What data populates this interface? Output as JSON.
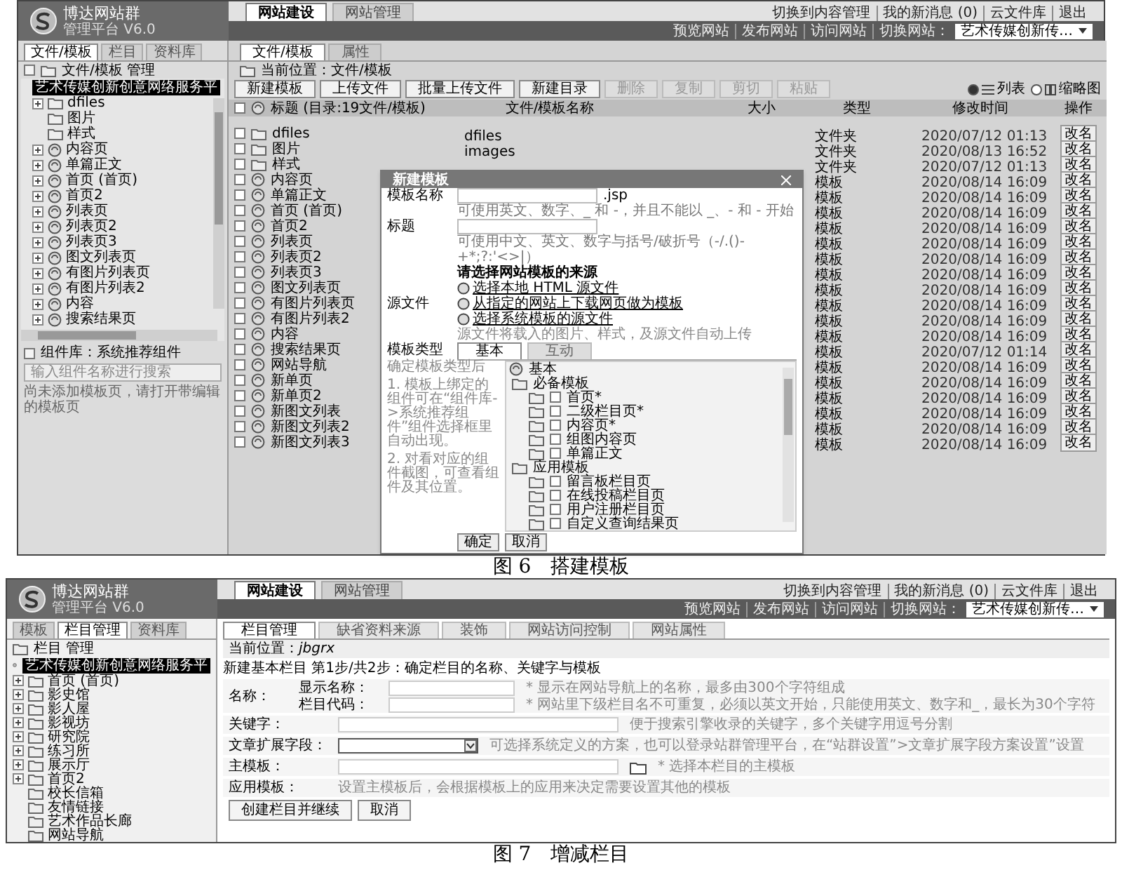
{
  "figure_6": {
    "header": {
      "logo": "博达网站群",
      "version": "管理平台 V6.0",
      "nav_tabs": [
        {
          "label": "网站建设",
          "selected": true
        },
        {
          "label": "网站管理",
          "selected": false
        }
      ],
      "top_links": [
        "切换到内容管理",
        "我的新消息 (0)",
        "云文件库",
        "退出"
      ],
      "site_links": [
        "预览网站",
        "发布网站",
        "访问网站",
        "切换网站："
      ],
      "site_select": "艺术传媒创新传…"
    },
    "sidebar": {
      "tabs": [
        {
          "label": "文件/模板",
          "selected": true
        },
        {
          "label": "栏目",
          "selected": false
        },
        {
          "label": "资料库",
          "selected": false
        }
      ],
      "title": "文件/模板 管理",
      "tree_root": {
        "label": "艺术传媒创新创意网络服务平",
        "selected": true
      },
      "tree_items": [
        {
          "label": "dfiles",
          "kind": "folder",
          "expandable": true
        },
        {
          "label": "图片",
          "kind": "folder",
          "expandable": false
        },
        {
          "label": "样式",
          "kind": "folder",
          "expandable": false
        },
        {
          "label": "内容页",
          "kind": "template",
          "expandable": true
        },
        {
          "label": "单篇正文",
          "kind": "template",
          "expandable": true
        },
        {
          "label": "首页 (首页)",
          "kind": "template",
          "expandable": true
        },
        {
          "label": "首页2",
          "kind": "template",
          "expandable": true
        },
        {
          "label": "列表页",
          "kind": "template",
          "expandable": true
        },
        {
          "label": "列表页2",
          "kind": "template",
          "expandable": true
        },
        {
          "label": "列表页3",
          "kind": "template",
          "expandable": true
        },
        {
          "label": "图文列表页",
          "kind": "template",
          "expandable": true
        },
        {
          "label": "有图片列表页",
          "kind": "template",
          "expandable": true
        },
        {
          "label": "有图片列表2",
          "kind": "template",
          "expandable": true
        },
        {
          "label": "内容",
          "kind": "template",
          "expandable": true
        },
        {
          "label": "搜索结果页",
          "kind": "template",
          "expandable": true
        }
      ],
      "component_library": "组件库：系统推荐组件",
      "component_search": {
        "placeholder": "输入组件名称进行搜索"
      },
      "hint": "尚未添加模板页，请打开带编辑的模板页"
    },
    "main": {
      "tabs": [
        {
          "label": "文件/模板",
          "selected": true
        },
        {
          "label": "属性",
          "selected": false
        }
      ],
      "location": "当前位置：文件/模板",
      "toolbar": [
        {
          "label": "新建模板",
          "disabled": false
        },
        {
          "label": "上传文件",
          "disabled": false
        },
        {
          "label": "批量上传文件",
          "disabled": false
        },
        {
          "label": "新建目录",
          "disabled": false
        },
        {
          "label": "删除",
          "disabled": true
        },
        {
          "label": "复制",
          "disabled": true
        },
        {
          "label": "剪切",
          "disabled": true
        },
        {
          "label": "粘贴",
          "disabled": true
        }
      ],
      "view_options": [
        {
          "label": "列表",
          "kind": "list",
          "selected": true
        },
        {
          "label": "缩略图",
          "kind": "grid",
          "selected": false
        }
      ],
      "table": {
        "columns": [
          "标题 (目录:19文件/模板)",
          "文件/模板名称",
          "大小",
          "类型",
          "修改时间",
          "操作"
        ],
        "select_all_checked": false,
        "rows": [
          {
            "title": "dfiles",
            "kind": "folder",
            "checked": false,
            "name": "dfiles",
            "type": "文件夹",
            "modified": "2020/07/12 01:13",
            "action": "改名"
          },
          {
            "title": "图片",
            "kind": "folder",
            "checked": false,
            "name": "images",
            "type": "文件夹",
            "modified": "2020/08/13 16:52",
            "action": "改名"
          },
          {
            "title": "样式",
            "kind": "folder",
            "checked": false,
            "type": "文件夹",
            "modified": "2020/07/12 01:13",
            "action": "改名"
          },
          {
            "title": "内容页",
            "kind": "template",
            "checked": false,
            "type": "模板",
            "modified": "2020/08/14 16:09",
            "action": "改名"
          },
          {
            "title": "单篇正文",
            "kind": "template",
            "checked": false,
            "type": "模板",
            "modified": "2020/08/14 16:09",
            "action": "改名"
          },
          {
            "title": "首页 (首页)",
            "kind": "template",
            "checked": false,
            "type": "模板",
            "modified": "2020/08/14 16:09",
            "action": "改名"
          },
          {
            "title": "首页2",
            "kind": "template",
            "checked": false,
            "type": "模板",
            "modified": "2020/08/14 16:09",
            "action": "改名"
          },
          {
            "title": "列表页",
            "kind": "template",
            "checked": false,
            "type": "模板",
            "modified": "2020/08/14 16:09",
            "action": "改名"
          },
          {
            "title": "列表页2",
            "kind": "template",
            "checked": false,
            "type": "模板",
            "modified": "2020/08/14 16:09",
            "action": "改名"
          },
          {
            "title": "列表页3",
            "kind": "template",
            "checked": false,
            "type": "模板",
            "modified": "2020/08/14 16:09",
            "action": "改名"
          },
          {
            "title": "图文列表页",
            "kind": "template",
            "checked": false,
            "type": "模板",
            "modified": "2020/08/14 16:09",
            "action": "改名"
          },
          {
            "title": "有图片列表页",
            "kind": "template",
            "checked": false,
            "type": "模板",
            "modified": "2020/08/14 16:09",
            "action": "改名"
          },
          {
            "title": "有图片列表2",
            "kind": "template",
            "checked": false,
            "type": "模板",
            "modified": "2020/08/14 16:09",
            "action": "改名"
          },
          {
            "title": "内容",
            "kind": "template",
            "checked": false,
            "type": "模板",
            "modified": "2020/08/14 16:09",
            "action": "改名"
          },
          {
            "title": "搜索结果页",
            "kind": "template",
            "checked": false,
            "type": "模板",
            "modified": "2020/07/12 01:14",
            "action": "改名"
          },
          {
            "title": "网站导航",
            "kind": "template",
            "checked": false,
            "type": "模板",
            "modified": "2020/08/14 16:09",
            "action": "改名"
          },
          {
            "title": "新单页",
            "kind": "template",
            "checked": false,
            "type": "模板",
            "modified": "2020/08/14 16:09",
            "action": "改名"
          },
          {
            "title": "新单页2",
            "kind": "template",
            "checked": false,
            "type": "模板",
            "modified": "2020/08/14 16:09",
            "action": "改名"
          },
          {
            "title": "新图文列表",
            "kind": "template",
            "checked": false,
            "type": "模板",
            "modified": "2020/08/14 16:09",
            "action": "改名"
          },
          {
            "title": "新图文列表2",
            "kind": "template",
            "checked": false,
            "type": "模板",
            "modified": "2020/08/14 16:09",
            "action": "改名"
          },
          {
            "title": "新图文列表3",
            "kind": "template",
            "checked": false,
            "type": "模板",
            "modified": "2020/08/14 16:09",
            "action": "改名"
          }
        ]
      }
    },
    "dialog": {
      "title": "新建模板",
      "fields": [
        {
          "label": "模板名称",
          "suffix": ".jsp",
          "hint": "可使用英文、数字、_ 和 -，并且不能以 _、- 和 - 开始"
        },
        {
          "label": "标题",
          "hint": "可使用中文、英文、数字与括号/破折号（-/.()-+*;?:'<>|）"
        }
      ],
      "source": {
        "label": "源文件",
        "heading": "请选择网站模板的来源",
        "links": [
          "选择本地 HTML 源文件",
          "从指定的网站上下载网页做为模板",
          "选择系统模板的源文件"
        ],
        "note": "源文件将载入的图片、样式，及源文件自动上传"
      },
      "template_type": {
        "label": "模板类型",
        "tabs": [
          {
            "label": "基本",
            "selected": true
          },
          {
            "label": "互动",
            "selected": false
          }
        ],
        "help": [
          "确定模板类型后",
          "1. 模板上绑定的组件可在“组件库->系统推荐组件”组件选择框里自动出现。",
          "2. 对看对应的组件截图，可查看组件及其位置。"
        ],
        "tree": {
          "label": "基本",
          "children": [
            {
              "label": "必备模板",
              "children": [
                {
                  "label": "首页*",
                  "checked": false
                },
                {
                  "label": "二级栏目页*",
                  "checked": false
                },
                {
                  "label": "内容页*",
                  "checked": false
                },
                {
                  "label": "组图内容页",
                  "checked": false
                },
                {
                  "label": "单篇正文",
                  "checked": false
                }
              ]
            },
            {
              "label": "应用模板",
              "children": [
                {
                  "label": "留言板栏目页",
                  "checked": false
                },
                {
                  "label": "在线投稿栏目页",
                  "checked": false
                },
                {
                  "label": "用户注册栏目页",
                  "checked": false
                },
                {
                  "label": "自定义查询结果页",
                  "checked": false
                }
              ]
            }
          ]
        }
      },
      "buttons": [
        "确定",
        "取消"
      ]
    },
    "caption": "图 6　搭建模板"
  },
  "figure_7": {
    "header": {
      "logo": "博达网站群",
      "version": "管理平台 V6.0",
      "nav_tabs": [
        {
          "label": "网站建设",
          "selected": true
        },
        {
          "label": "网站管理",
          "selected": false
        }
      ],
      "top_links": [
        "切换到内容管理",
        "我的新消息 (0)",
        "云文件库",
        "退出"
      ],
      "site_links": [
        "预览网站",
        "发布网站",
        "访问网站",
        "切换网站："
      ],
      "site_select": "艺术传媒创新传…"
    },
    "sidebar": {
      "tabs": [
        {
          "label": "模板",
          "selected": false
        },
        {
          "label": "栏目管理",
          "selected": true
        },
        {
          "label": "资料库",
          "selected": false
        }
      ],
      "title": "栏目 管理",
      "tree_root": {
        "label": "艺术传媒创新创意网络服务平",
        "selected": true
      },
      "tree_items": [
        {
          "label": "首页 (首页)",
          "expandable": true
        },
        {
          "label": "影史馆",
          "expandable": true
        },
        {
          "label": "影人屋",
          "expandable": true
        },
        {
          "label": "影视坊",
          "expandable": true
        },
        {
          "label": "研究院",
          "expandable": true
        },
        {
          "label": "练习所",
          "expandable": true
        },
        {
          "label": "展示厅",
          "expandable": true
        },
        {
          "label": "首页2",
          "expandable": true
        },
        {
          "label": "校长信箱",
          "expandable": false
        },
        {
          "label": "友情链接",
          "expandable": false
        },
        {
          "label": "艺术作品长廊",
          "expandable": false
        },
        {
          "label": "网站导航",
          "expandable": false
        }
      ]
    },
    "main": {
      "tabs": [
        {
          "label": "栏目管理",
          "selected": true
        },
        {
          "label": "缺省资料来源",
          "selected": false
        },
        {
          "label": "装饰",
          "selected": false
        },
        {
          "label": "网站访问控制",
          "selected": false
        },
        {
          "label": "网站属性",
          "selected": false
        }
      ],
      "location_label": "当前位置：",
      "location": "jbgrx",
      "form": {
        "heading": "新建基本栏目 第1步/共2步：确定栏目的名称、关键字与模板",
        "name_group": {
          "label": "名称：",
          "fields": [
            {
              "label": "显示名称：",
              "hint": "* 显示在网站导航上的名称，最多由300个字符组成"
            },
            {
              "label": "栏目代码：",
              "hint": "* 网站里下级栏目名不可重复，必须以英文开始，只能使用英文、数字和_，最长为30个字符"
            }
          ]
        },
        "keyword": {
          "label": "关键字：",
          "hint": "便于搜索引擎收录的关键字，多个关键字用逗号分割"
        },
        "extension_field": {
          "label": "文章扩展字段：",
          "hint": "可选择系统定义的方案，也可以登录站群管理平台，在“站群设置”>文章扩展字段方案设置”设置"
        },
        "main_template": {
          "label": "主模板：",
          "hint": "* 选择本栏目的主模板"
        },
        "app_template": {
          "label": "应用模板：",
          "text": "设置主模板后，会根据模板上的应用来决定需要设置其他的模板"
        },
        "buttons": [
          "创建栏目并继续",
          "取消"
        ]
      }
    },
    "caption": "图 7　增减栏目"
  }
}
